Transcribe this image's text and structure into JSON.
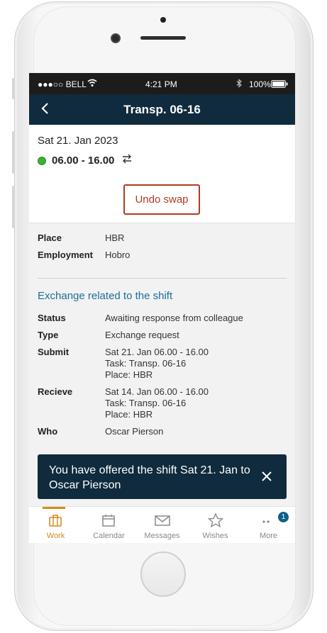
{
  "status_bar": {
    "carrier": "●●●○○ BELL",
    "time": "4:21 PM",
    "battery": "100%"
  },
  "nav": {
    "title": "Transp. 06-16",
    "back_icon": "chevron-left-icon"
  },
  "shift": {
    "date": "Sat 21. Jan 2023",
    "time_range": "06.00 - 16.00",
    "status_color": "#3fae3a",
    "undo_label": "Undo swap"
  },
  "details": [
    {
      "label": "Place",
      "value": "HBR"
    },
    {
      "label": "Employment",
      "value": "Hobro"
    }
  ],
  "exchange": {
    "heading": "Exchange related to the shift",
    "rows": [
      {
        "label": "Status",
        "lines": [
          "Awaiting response from colleague"
        ]
      },
      {
        "label": "Type",
        "lines": [
          "Exchange request"
        ]
      },
      {
        "label": "Submit",
        "lines": [
          "Sat 21. Jan 06.00 - 16.00",
          "Task: Transp. 06-16",
          "Place: HBR"
        ]
      },
      {
        "label": "Recieve",
        "lines": [
          "Sat 14. Jan 06.00 - 16.00",
          "Task: Transp. 06-16",
          "Place: HBR"
        ]
      },
      {
        "label": "Who",
        "lines": [
          "Oscar Pierson"
        ]
      }
    ]
  },
  "toast": {
    "message": "You have offered the shift Sat 21. Jan to Oscar Pierson",
    "close_icon": "close-icon"
  },
  "tabs": [
    {
      "label": "Work",
      "icon": "briefcase-icon",
      "active": true
    },
    {
      "label": "Calendar",
      "icon": "calendar-icon",
      "active": false
    },
    {
      "label": "Messages",
      "icon": "envelope-icon",
      "active": false
    },
    {
      "label": "Wishes",
      "icon": "star-icon",
      "active": false
    },
    {
      "label": "More",
      "icon": "more-icon",
      "active": false,
      "badge": "1"
    }
  ],
  "colors": {
    "navbar": "#0f2b3d",
    "accent": "#d8891d",
    "link": "#1f6e9a",
    "undo": "#b23a22"
  }
}
